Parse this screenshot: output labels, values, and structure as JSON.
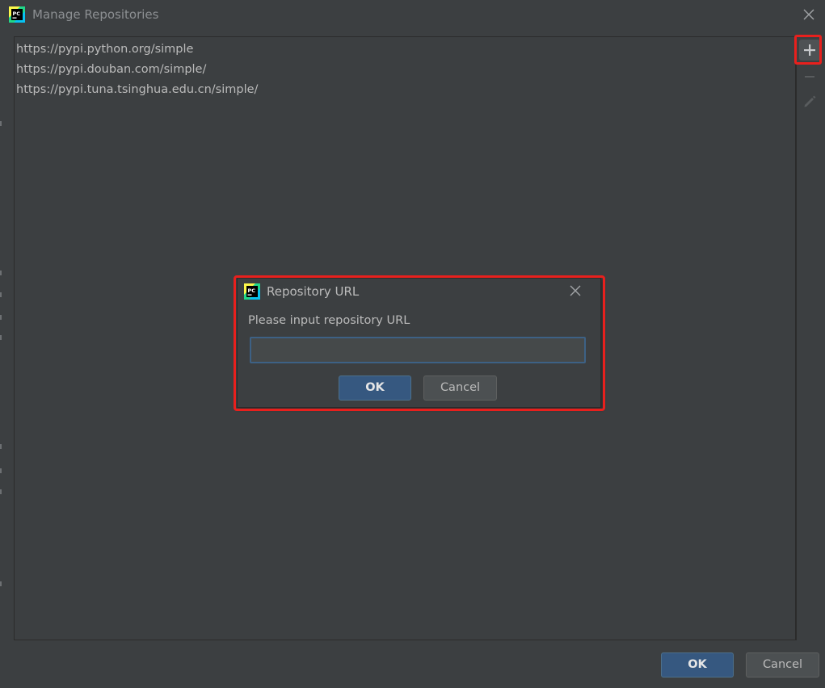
{
  "window": {
    "title": "Manage Repositories",
    "icon": "pycharm-logo-icon"
  },
  "repositories": [
    "https://pypi.python.org/simple",
    "https://pypi.douban.com/simple/",
    "https://pypi.tuna.tsinghua.edu.cn/simple/"
  ],
  "toolbar": {
    "add_icon": "plus-icon",
    "remove_icon": "minus-icon",
    "edit_icon": "pencil-icon"
  },
  "buttons": {
    "ok_label": "OK",
    "cancel_label": "Cancel"
  },
  "dialog": {
    "title": "Repository URL",
    "icon": "pycharm-logo-icon",
    "prompt": "Please input repository URL",
    "input_value": "",
    "ok_label": "OK",
    "cancel_label": "Cancel"
  },
  "colors": {
    "background": "#3c3f41",
    "primary_button": "#365880",
    "highlight": "#e8201d"
  }
}
